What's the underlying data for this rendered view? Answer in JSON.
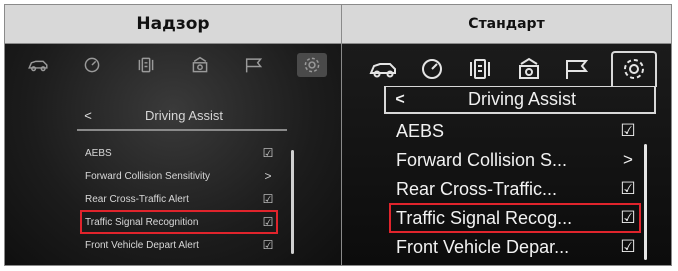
{
  "columns": [
    {
      "header": "Надзор",
      "screen": {
        "icons": [
          "car-icon",
          "gauge-icon",
          "settings-list-icon",
          "camera-icon",
          "flag-icon",
          "gear-icon"
        ],
        "active_icon": "gear-icon",
        "back_glyph": "<",
        "title": "Driving Assist",
        "items": [
          {
            "label": "AEBS",
            "control": "☑"
          },
          {
            "label": "Forward Collision Sensitivity",
            "control": ">"
          },
          {
            "label": "Rear Cross-Traffic Alert",
            "control": "☑"
          },
          {
            "label": "Traffic Signal Recognition",
            "control": "☑"
          },
          {
            "label": "Front Vehicle Depart Alert",
            "control": "☑"
          }
        ],
        "highlighted_index": 3
      }
    },
    {
      "header": "Стандарт",
      "screen": {
        "icons": [
          "car-icon",
          "gauge-icon",
          "settings-list-icon",
          "camera-icon",
          "flag-icon",
          "gear-icon"
        ],
        "active_icon": "gear-icon",
        "back_glyph": "<",
        "title": "Driving Assist",
        "items": [
          {
            "label": "AEBS",
            "control": "☑"
          },
          {
            "label": "Forward Collision S...",
            "control": ">"
          },
          {
            "label": "Rear Cross-Traffic...",
            "control": "☑"
          },
          {
            "label": "Traffic Signal Recog...",
            "control": "☑"
          },
          {
            "label": "Front Vehicle Depar...",
            "control": "☑"
          }
        ],
        "highlighted_index": 3
      }
    }
  ],
  "colors": {
    "highlight": "#e0242c",
    "header_bg": "#d8d8d8",
    "screen_bg": "#121212"
  }
}
